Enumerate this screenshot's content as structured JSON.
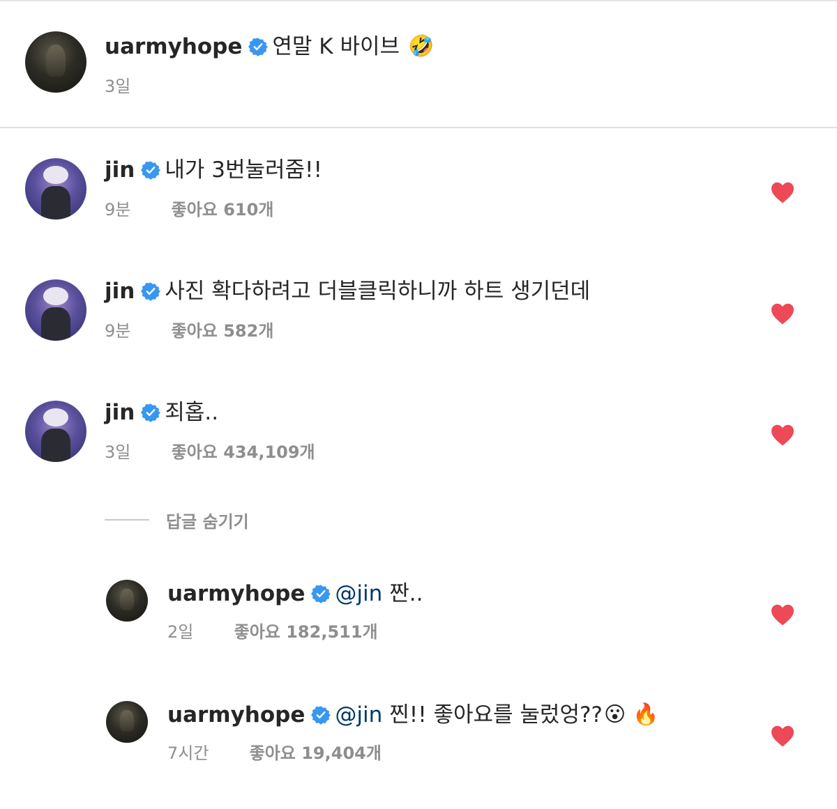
{
  "post": {
    "username": "uarmyhope",
    "caption": "연말 K 바이브",
    "caption_emoji": "🤣",
    "time": "3일"
  },
  "comments": [
    {
      "username": "jin",
      "text": "내가 3번눌러줌!!",
      "time": "9분",
      "likes": "좋아요 610개"
    },
    {
      "username": "jin",
      "text": "사진 확다하려고 더블클릭하니까 하트 생기던데",
      "time": "9분",
      "likes": "좋아요 582개"
    },
    {
      "username": "jin",
      "text": "죄홉..",
      "time": "3일",
      "likes": "좋아요 434,109개"
    }
  ],
  "replies_toggle": {
    "label": "답글 숨기기"
  },
  "replies": [
    {
      "username": "uarmyhope",
      "mention": "@jin",
      "text": "짠..",
      "time": "2일",
      "likes": "좋아요 182,511개"
    },
    {
      "username": "uarmyhope",
      "mention": "@jin",
      "text": "찐!! 좋아요를 눌렀엉??",
      "emoji1": "😮",
      "emoji2": "🔥",
      "time": "7시간",
      "likes": "좋아요 19,404개"
    }
  ],
  "colors": {
    "verified_badge": "#3897f0",
    "liked_heart": "#ed4956",
    "mention": "#00376b",
    "secondary_text": "#8e8e8e"
  },
  "icons": {
    "verified": "verified-badge-icon",
    "like": "heart-filled-icon"
  }
}
